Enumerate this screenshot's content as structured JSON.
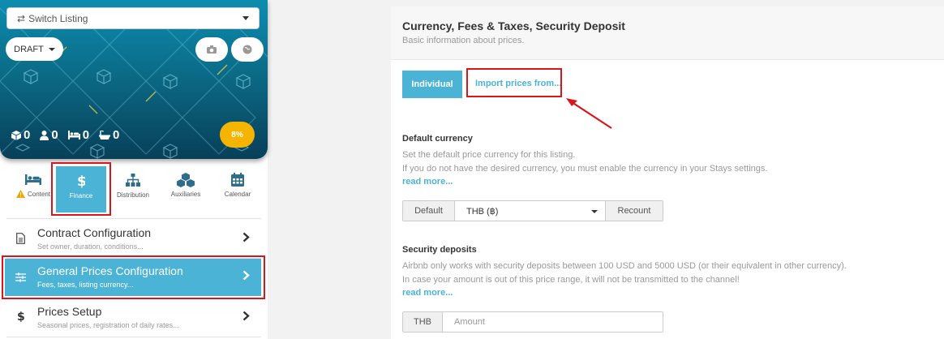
{
  "sidebar": {
    "switch_listing": "Switch Listing",
    "status": "DRAFT",
    "stats": {
      "rooms": "0",
      "guests": "0",
      "beds": "0",
      "baths": "0"
    },
    "completion": "8%",
    "nav": [
      {
        "label": "Content",
        "icon": "bed-icon",
        "warning": true
      },
      {
        "label": "Finance",
        "icon": "dollar-icon",
        "active": true
      },
      {
        "label": "Distribution",
        "icon": "sitemap-icon"
      },
      {
        "label": "Auxiliaries",
        "icon": "cubes-icon"
      },
      {
        "label": "Calendar",
        "icon": "calendar-icon"
      }
    ],
    "menu": [
      {
        "title": "Contract Configuration",
        "subtitle": "Set owner, duration, conditions...",
        "icon": "document-icon"
      },
      {
        "title": "General Prices Configuration",
        "subtitle": "Fees, taxes, listing currency...",
        "icon": "sliders-icon",
        "active": true
      },
      {
        "title": "Prices Setup",
        "subtitle": "Seasonal prices, registration of daily rates...",
        "icon": "dollar-icon"
      }
    ]
  },
  "panel": {
    "title": "Currency, Fees & Taxes, Security Deposit",
    "subtitle": "Basic information about prices.",
    "individual_label": "Individual",
    "import_label": "Import prices from...",
    "currency": {
      "title": "Default currency",
      "help_1": "Set the default price currency for this listing.",
      "help_2": "If you do not have the desired currency, you must enable the currency in your Stays settings.",
      "read_more": "read more...",
      "addon": "Default",
      "selected": "THB (฿)",
      "recount": "Recount"
    },
    "deposit": {
      "title": "Security deposits",
      "help_1": "Airbnb only works with security deposits between 100 USD and 5000 USD (or their equivalent in other currency).",
      "help_2": "In case your amount is out of this price range, it will not be transmitted to the channel!",
      "read_more": "read more...",
      "addon": "THB",
      "placeholder": "Amount"
    }
  },
  "colors": {
    "accent": "#4bb3d6",
    "highlight": "#d9161b",
    "badge": "#f5b400"
  }
}
